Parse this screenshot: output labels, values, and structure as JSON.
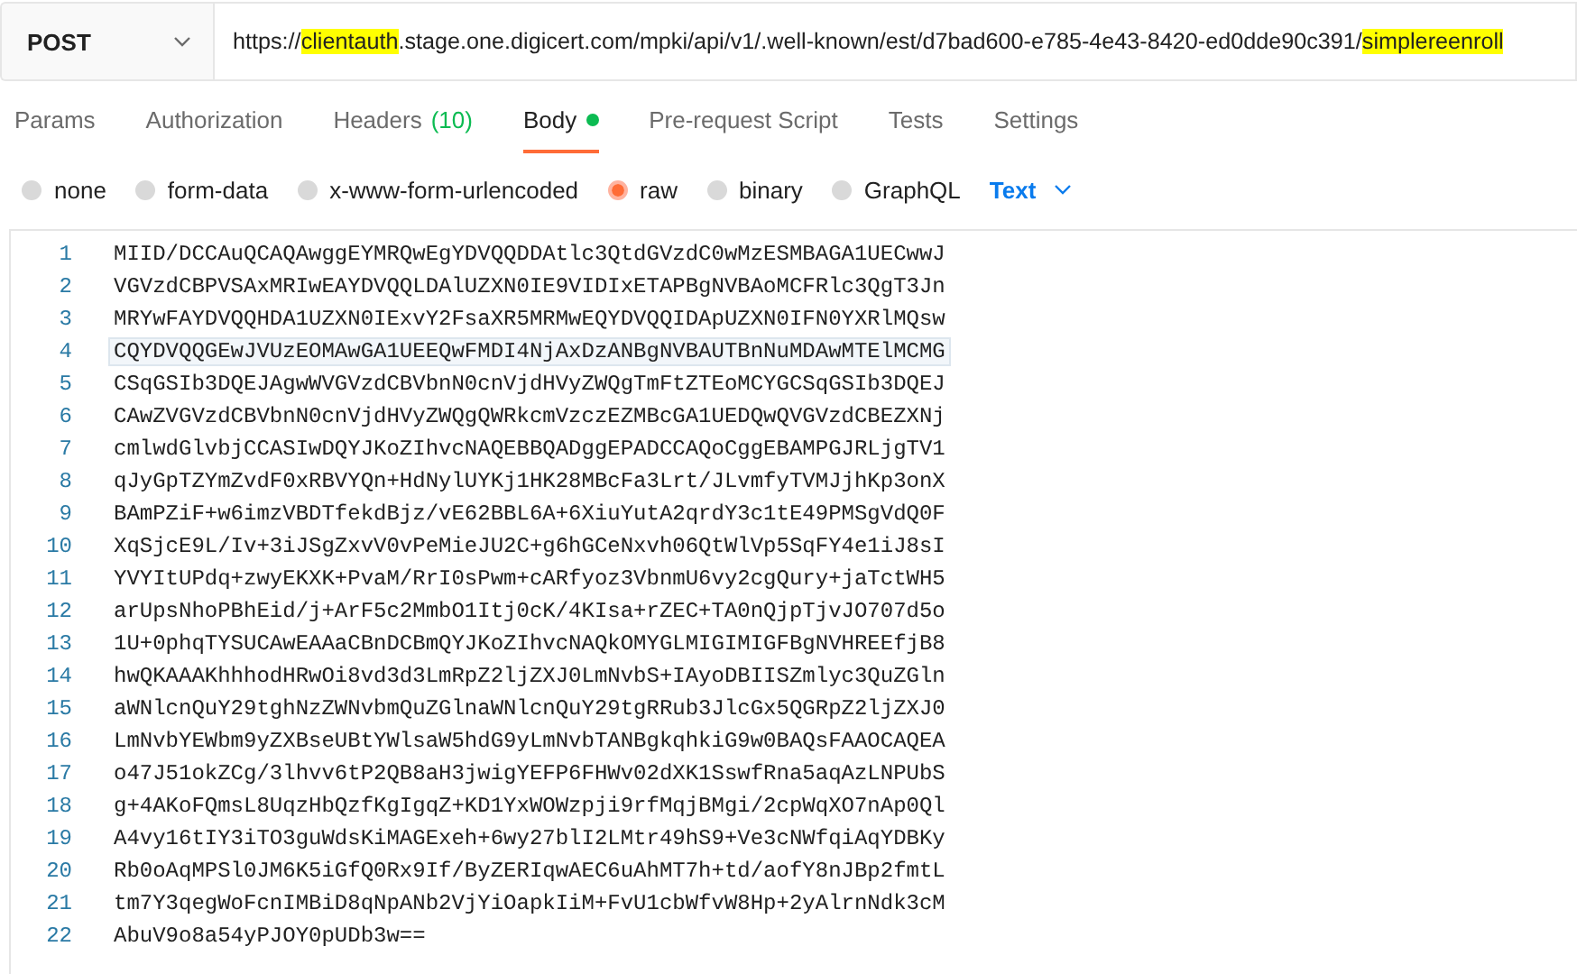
{
  "request": {
    "method": "POST",
    "url_parts": [
      {
        "text": "https://",
        "highlighted": false
      },
      {
        "text": "clientauth",
        "highlighted": true
      },
      {
        "text": ".stage.one.digicert.com/mpki/api/v1/.well-known/est/d7bad600-e785-4e43-8420-ed0dde90c391/",
        "highlighted": false
      },
      {
        "text": "simplereenroll",
        "highlighted": true
      }
    ]
  },
  "tabs": [
    {
      "label": "Params",
      "selected": false,
      "dot": false
    },
    {
      "label": "Authorization",
      "selected": false,
      "dot": false
    },
    {
      "label": "Headers",
      "count": "(10)",
      "selected": false,
      "dot": false
    },
    {
      "label": "Body",
      "selected": true,
      "dot": true
    },
    {
      "label": "Pre-request Script",
      "selected": false,
      "dot": false
    },
    {
      "label": "Tests",
      "selected": false,
      "dot": false
    },
    {
      "label": "Settings",
      "selected": false,
      "dot": false
    }
  ],
  "body_types": [
    {
      "label": "none",
      "selected": false
    },
    {
      "label": "form-data",
      "selected": false
    },
    {
      "label": "x-www-form-urlencoded",
      "selected": false
    },
    {
      "label": "raw",
      "selected": true
    },
    {
      "label": "binary",
      "selected": false
    },
    {
      "label": "GraphQL",
      "selected": false
    }
  ],
  "format": {
    "label": "Text"
  },
  "editor": {
    "lines": [
      {
        "number": "1",
        "text": "MIID/DCCAuQCAQAwggEYMRQwEgYDVQQDDAtlc3QtdGVzdC0wMzESMBAGA1UECwwJ",
        "current": false
      },
      {
        "number": "2",
        "text": "VGVzdCBPVSAxMRIwEAYDVQQLDAlUZXN0IE9VIDIxETAPBgNVBAoMCFRlc3QgT3Jn",
        "current": false
      },
      {
        "number": "3",
        "text": "MRYwFAYDVQQHDA1UZXN0IExvY2FsaXR5MRMwEQYDVQQIDApUZXN0IFN0YXRlMQsw",
        "current": false
      },
      {
        "number": "4",
        "text": "CQYDVQQGEwJVUzEOMAwGA1UEEQwFMDI4NjAxDzANBgNVBAUTBnNuMDAwMTElMCMG",
        "current": true
      },
      {
        "number": "5",
        "text": "CSqGSIb3DQEJAgwWVGVzdCBVbnN0cnVjdHVyZWQgTmFtZTEoMCYGCSqGSIb3DQEJ",
        "current": false
      },
      {
        "number": "6",
        "text": "CAwZVGVzdCBVbnN0cnVjdHVyZWQgQWRkcmVzczEZMBcGA1UEDQwQVGVzdCBEZXNj",
        "current": false
      },
      {
        "number": "7",
        "text": "cmlwdGlvbjCCASIwDQYJKoZIhvcNAQEBBQADggEPADCCAQoCggEBAMPGJRLjgTV1",
        "current": false
      },
      {
        "number": "8",
        "text": "qJyGpTZYmZvdF0xRBVYQn+HdNylUYKj1HK28MBcFa3Lrt/JLvmfyTVMJjhKp3onX",
        "current": false
      },
      {
        "number": "9",
        "text": "BAmPZiF+w6imzVBDTfekdBjz/vE62BBL6A+6XiuYutA2qrdY3c1tE49PMSgVdQ0F",
        "current": false
      },
      {
        "number": "10",
        "text": "XqSjcE9L/Iv+3iJSgZxvV0vPeMieJU2C+g6hGCeNxvh06QtWlVp5SqFY4e1iJ8sI",
        "current": false
      },
      {
        "number": "11",
        "text": "YVYItUPdq+zwyEKXK+PvaM/RrI0sPwm+cARfyoz3VbnmU6vy2cgQury+jaTctWH5",
        "current": false
      },
      {
        "number": "12",
        "text": "arUpsNhoPBhEid/j+ArF5c2MmbO1Itj0cK/4KIsa+rZEC+TA0nQjpTjvJO707d5o",
        "current": false
      },
      {
        "number": "13",
        "text": "1U+0phqTYSUCAwEAAaCBnDCBmQYJKoZIhvcNAQkOMYGLMIGIMIGFBgNVHREEfjB8",
        "current": false
      },
      {
        "number": "14",
        "text": "hwQKAAAKhhhodHRwOi8vd3d3LmRpZ2ljZXJ0LmNvbS+IAyoDBIISZmlyc3QuZGln",
        "current": false
      },
      {
        "number": "15",
        "text": "aWNlcnQuY29tghNzZWNvbmQuZGlnaWNlcnQuY29tgRRub3JlcGx5QGRpZ2ljZXJ0",
        "current": false
      },
      {
        "number": "16",
        "text": "LmNvbYEWbm9yZXBseUBtYWlsaW5hdG9yLmNvbTANBgkqhkiG9w0BAQsFAAOCAQEA",
        "current": false
      },
      {
        "number": "17",
        "text": "o47J51okZCg/3lhvv6tP2QB8aH3jwigYEFP6FHWv02dXK1SswfRna5aqAzLNPUbS",
        "current": false
      },
      {
        "number": "18",
        "text": "g+4AKoFQmsL8UqzHbQzfKgIgqZ+KD1YxWOWzpji9rfMqjBMgi/2cpWqXO7nAp0Ql",
        "current": false
      },
      {
        "number": "19",
        "text": "A4vy16tIY3iTO3guWdsKiMAGExeh+6wy27blI2LMtr49hS9+Ve3cNWfqiAqYDBKy",
        "current": false
      },
      {
        "number": "20",
        "text": "Rb0oAqMPSl0JM6K5iGfQ0Rx9If/ByZERIqwAEC6uAhMT7h+td/aofY8nJBp2fmtL",
        "current": false
      },
      {
        "number": "21",
        "text": "tm7Y3qegWoFcnIMBiD8qNpANb2VjYiOapkIiM+FvU1cbWfvW8Hp+2yAlrnNdk3cM",
        "current": false
      },
      {
        "number": "22",
        "text": "AbuV9o8a54yPJOY0pUDb3w==",
        "current": false
      }
    ]
  }
}
